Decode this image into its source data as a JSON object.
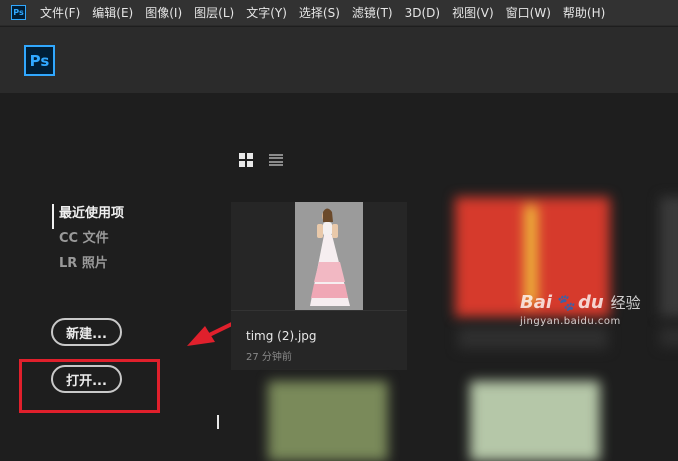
{
  "menubar": {
    "app_icon": "Ps",
    "items": [
      {
        "label": "文件(F)"
      },
      {
        "label": "编辑(E)"
      },
      {
        "label": "图像(I)"
      },
      {
        "label": "图层(L)"
      },
      {
        "label": "文字(Y)"
      },
      {
        "label": "选择(S)"
      },
      {
        "label": "滤镜(T)"
      },
      {
        "label": "3D(D)"
      },
      {
        "label": "视图(V)"
      },
      {
        "label": "窗口(W)"
      },
      {
        "label": "帮助(H)"
      }
    ]
  },
  "header": {
    "logo": "Ps"
  },
  "view_toggle": {
    "grid_icon": "grid-view-icon",
    "list_icon": "list-view-icon"
  },
  "sidebar": {
    "items": [
      {
        "label": "最近使用项",
        "active": true
      },
      {
        "label": "CC 文件",
        "active": false
      },
      {
        "label": "LR 照片",
        "active": false
      }
    ]
  },
  "buttons": {
    "new_label": "新建...",
    "open_label": "打开..."
  },
  "recent_file": {
    "name": "timg (2).jpg",
    "time": "27 分钟前"
  },
  "annotation": {
    "color": "#e0202c",
    "arrow_icon": "arrow-left-icon"
  },
  "watermark": {
    "logo": "Bai",
    "logo_suffix": "du",
    "cn": "经验",
    "url": "jingyan.baidu.com"
  },
  "colors": {
    "accent": "#31a8ff",
    "background": "#1e1e1e",
    "menubar": "#323232"
  }
}
